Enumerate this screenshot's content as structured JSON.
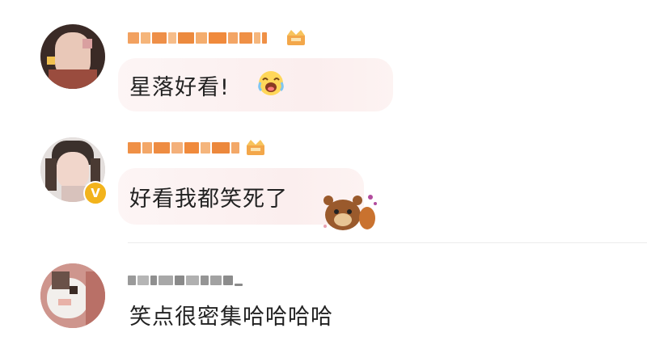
{
  "colors": {
    "bubble": "#fbeeee",
    "username_orange": "#f08a3c",
    "username_gray": "#8a8a8a",
    "verified_badge": "#f2b31c",
    "divider": "#ececec"
  },
  "comments": [
    {
      "avatar_icon": "user-avatar-icon",
      "username_blurred": true,
      "username_color": "orange",
      "badge_icon": "crown-icon",
      "text": "星落好看!",
      "emoji_icon": "crying-laughing-face-icon",
      "highlighted_bubble": true
    },
    {
      "avatar_icon": "user-avatar-icon",
      "verified_icon": "verified-v-icon",
      "verified_label": "V",
      "username_blurred": true,
      "username_color": "orange",
      "badge_icon": "crown-icon",
      "text": "好看我都笑死了",
      "sticker_icon": "bear-sticker-icon",
      "highlighted_bubble": true
    },
    {
      "avatar_icon": "cat-avatar-icon",
      "username_blurred": true,
      "username_color": "gray",
      "text": "笑点很密集哈哈哈哈",
      "highlighted_bubble": false
    }
  ]
}
